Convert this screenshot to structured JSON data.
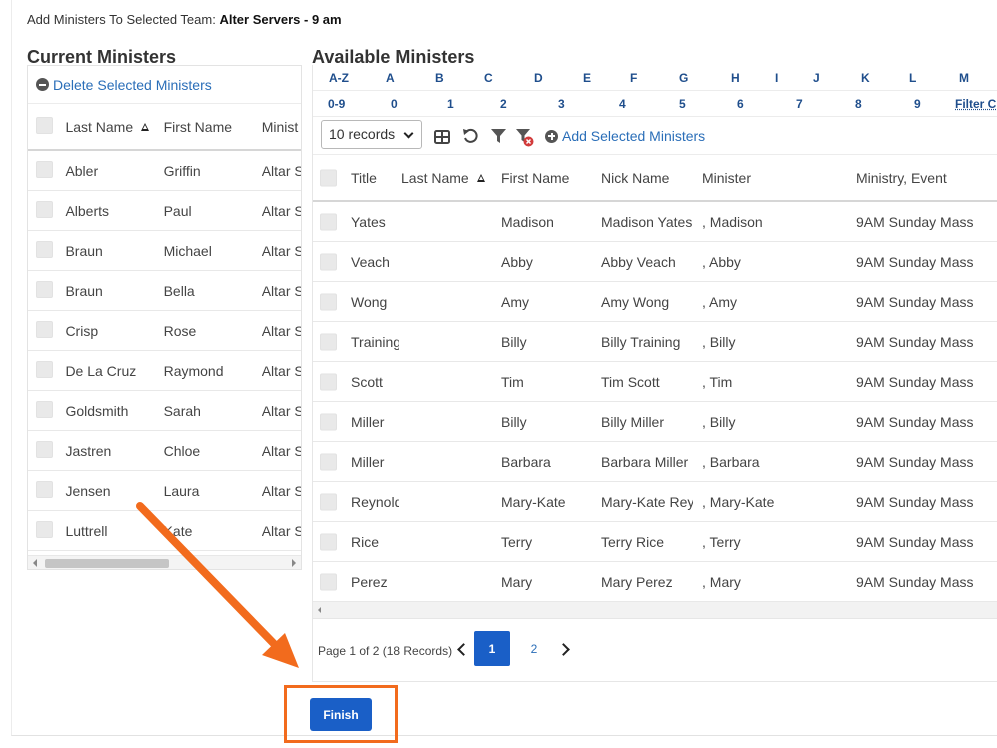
{
  "header": {
    "prefix": "Add Ministers To Selected Team:",
    "team": "Alter Servers - 9 am"
  },
  "current": {
    "title": "Current Ministers",
    "delete_label": "Delete Selected Ministers",
    "columns": [
      "Last Name",
      "First Name",
      "Minist"
    ],
    "rows": [
      {
        "last": "Abler",
        "first": "Griffin",
        "ministry": "Altar S"
      },
      {
        "last": "Alberts",
        "first": "Paul",
        "ministry": "Altar S"
      },
      {
        "last": "Braun",
        "first": "Michael",
        "ministry": "Altar S"
      },
      {
        "last": "Braun",
        "first": "Bella",
        "ministry": "Altar S"
      },
      {
        "last": "Crisp",
        "first": "Rose",
        "ministry": "Altar S"
      },
      {
        "last": "De La Cruz",
        "first": "Raymond",
        "ministry": "Altar S"
      },
      {
        "last": "Goldsmith",
        "first": "Sarah",
        "ministry": "Altar S"
      },
      {
        "last": "Jastren",
        "first": "Chloe",
        "ministry": "Altar S"
      },
      {
        "last": "Jensen",
        "first": "Laura",
        "ministry": "Altar S"
      },
      {
        "last": "Luttrell",
        "first": "Kate",
        "ministry": "Altar S"
      }
    ]
  },
  "available": {
    "title": "Available Ministers",
    "alpha_row1": [
      "A-Z",
      "A",
      "B",
      "C",
      "D",
      "E",
      "F",
      "G",
      "H",
      "I",
      "J",
      "K",
      "L",
      "M"
    ],
    "alpha_row2": [
      "0-9",
      "0",
      "1",
      "2",
      "3",
      "4",
      "5",
      "6",
      "7",
      "8",
      "9",
      "Filter C"
    ],
    "records_select": "10 records",
    "add_label": "Add Selected Ministers",
    "columns": [
      "Title",
      "Last Name",
      "First Name",
      "Nick Name",
      "Minister",
      "Ministry, Event"
    ],
    "rows": [
      {
        "title": "Yates",
        "first": "Madison",
        "nick": "Madison Yates",
        "minister": ", Madison",
        "event": "9AM Sunday Mass"
      },
      {
        "title": "Veach",
        "first": "Abby",
        "nick": "Abby Veach",
        "minister": ", Abby",
        "event": "9AM Sunday Mass"
      },
      {
        "title": "Wong",
        "first": "Amy",
        "nick": "Amy Wong",
        "minister": ", Amy",
        "event": "9AM Sunday Mass"
      },
      {
        "title": "Training",
        "first": "Billy",
        "nick": "Billy Training",
        "minister": ", Billy",
        "event": "9AM Sunday Mass"
      },
      {
        "title": "Scott",
        "first": "Tim",
        "nick": "Tim Scott",
        "minister": ", Tim",
        "event": "9AM Sunday Mass"
      },
      {
        "title": "Miller",
        "first": "Billy",
        "nick": "Billy Miller",
        "minister": ", Billy",
        "event": "9AM Sunday Mass"
      },
      {
        "title": "Miller",
        "first": "Barbara",
        "nick": "Barbara Miller",
        "minister": ", Barbara",
        "event": "9AM Sunday Mass"
      },
      {
        "title": "Reynolds",
        "first": "Mary-Kate",
        "nick": "Mary-Kate Reynolds",
        "minister": ", Mary-Kate",
        "event": "9AM Sunday Mass"
      },
      {
        "title": "Rice",
        "first": "Terry",
        "nick": "Terry Rice",
        "minister": ", Terry",
        "event": "9AM Sunday Mass"
      },
      {
        "title": "Perez",
        "first": "Mary",
        "nick": "Mary Perez",
        "minister": ", Mary",
        "event": "9AM Sunday Mass"
      }
    ],
    "pager": {
      "info": "Page 1 of 2 (18 Records)",
      "pages": [
        "1",
        "2"
      ],
      "current": "1"
    }
  },
  "finish_label": "Finish",
  "colors": {
    "accent": "#1a5fc7",
    "link": "#2a6eb8",
    "annotation": "#f26b1d"
  },
  "icons": [
    "minus-circle-icon",
    "grid-icon",
    "undo-icon",
    "filter-icon",
    "clear-filter-icon",
    "plus-circle-icon",
    "chevron-left-icon",
    "chevron-right-icon",
    "sort-asc-icon"
  ]
}
